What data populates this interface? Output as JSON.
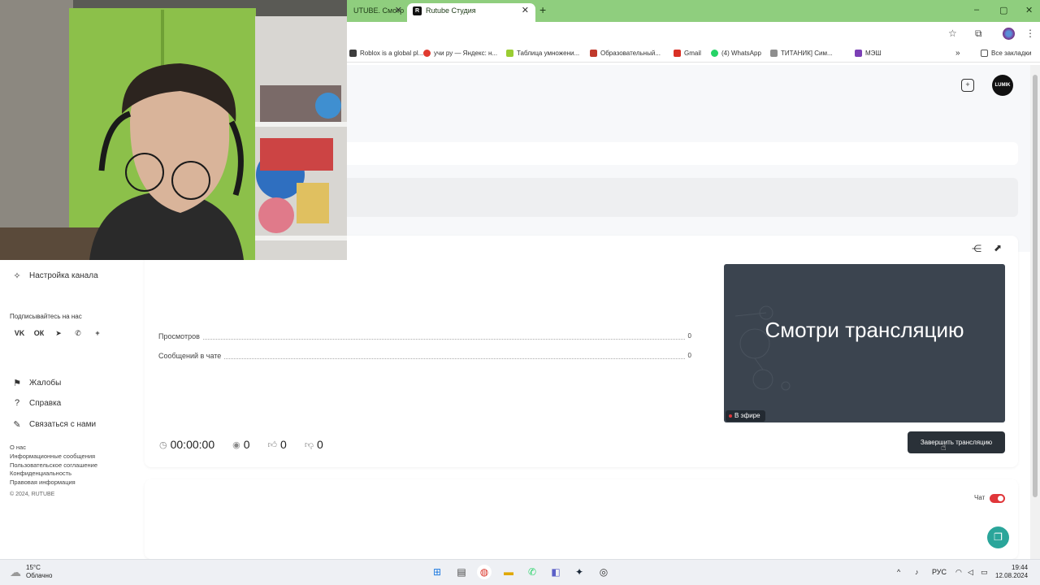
{
  "browser": {
    "tabs": [
      {
        "label": "UTUBE. Смотр",
        "close": "✕"
      },
      {
        "label": "Rutube Студия",
        "favicon": "R",
        "close": "✕"
      }
    ],
    "new_tab": "+",
    "window_controls": [
      "–",
      "▢",
      "✕"
    ],
    "toolbar_icons": {
      "star": "☆",
      "extensions": "⧉",
      "menu": "⋮"
    }
  },
  "bookmarks": {
    "items": [
      {
        "label": "Roblox is a global pl...",
        "color": "#3d3d3d"
      },
      {
        "label": "учи ру — Яндекс: н...",
        "color": "#e03a2f"
      },
      {
        "label": "Таблица умножени...",
        "color": "#9acd32"
      },
      {
        "label": "Образовательный...",
        "color": "#c0392b"
      },
      {
        "label": "Gmail",
        "color": "#d93025"
      },
      {
        "label": "(4) WhatsApp",
        "color": "#25d366"
      },
      {
        "label": "ТИТАНИК] Сим...",
        "color": "#8e8e8e"
      },
      {
        "label": "МЭШ",
        "color": "#7b3fb5"
      }
    ],
    "overflow": "»",
    "all_bookmarks": "Все закладки"
  },
  "header": {
    "avatar_text": "LUMIK",
    "add_icon": "+"
  },
  "sidebar": {
    "channel_settings": "Настройка канала",
    "follow_us": "Подписывайтесь на нас",
    "socials": [
      "vk",
      "ok",
      "tg",
      "vb",
      "+"
    ],
    "socials_display": [
      "VK",
      "ОК",
      "➤",
      "✆",
      "+"
    ],
    "nav": [
      {
        "label": "Жалобы",
        "icon": "⚑"
      },
      {
        "label": "Справка",
        "icon": "?"
      },
      {
        "label": "Связаться с нами",
        "icon": "✎"
      }
    ],
    "links": [
      "О нас",
      "Информационные сообщения",
      "Пользовательское соглашение",
      "Конфиденциальность",
      "Правовая информация"
    ],
    "copyright": "© 2024, RUTUBE"
  },
  "stream": {
    "stats": [
      {
        "label": "Просмотров",
        "value": "0"
      },
      {
        "label": "Сообщений в чате",
        "value": "0"
      }
    ],
    "duration": "00:00:00",
    "viewers": "0",
    "likes": "0",
    "dislikes": "0",
    "preview_title": "Смотри трансляцию",
    "live_badge": "В эфире",
    "end_button": "Завершить трансляцию",
    "chat_label": "Чат",
    "chat_enabled": true
  },
  "taskbar": {
    "temperature": "15°C",
    "weather": "Облачно",
    "language": "РУС",
    "time": "19:44",
    "date": "12.08.2024"
  },
  "colors": {
    "tabstrip": "#8fce7e",
    "accent_red": "#e0363a",
    "preview_bg": "#3b444f",
    "button_dark": "#2a3138",
    "support_teal": "#2aa59a"
  }
}
